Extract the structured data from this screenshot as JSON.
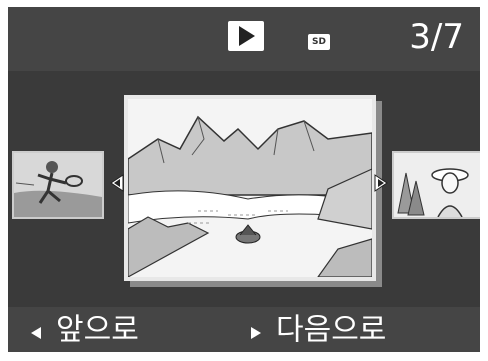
{
  "status": {
    "mode_icon": "play-icon",
    "media_icon": "sd-card-icon",
    "media_label": "SD",
    "counter": "3/7"
  },
  "viewer": {
    "prev_thumbnail": "tennis-player-thumbnail",
    "current_photo": "mountain-lake-landscape",
    "next_thumbnail": "woman-with-hat-thumbnail"
  },
  "nav": {
    "prev_label": "앞으로",
    "next_label": "다음으로"
  },
  "colors": {
    "background": "#3a3a3a",
    "bar": "#454545",
    "text": "#ffffff"
  }
}
